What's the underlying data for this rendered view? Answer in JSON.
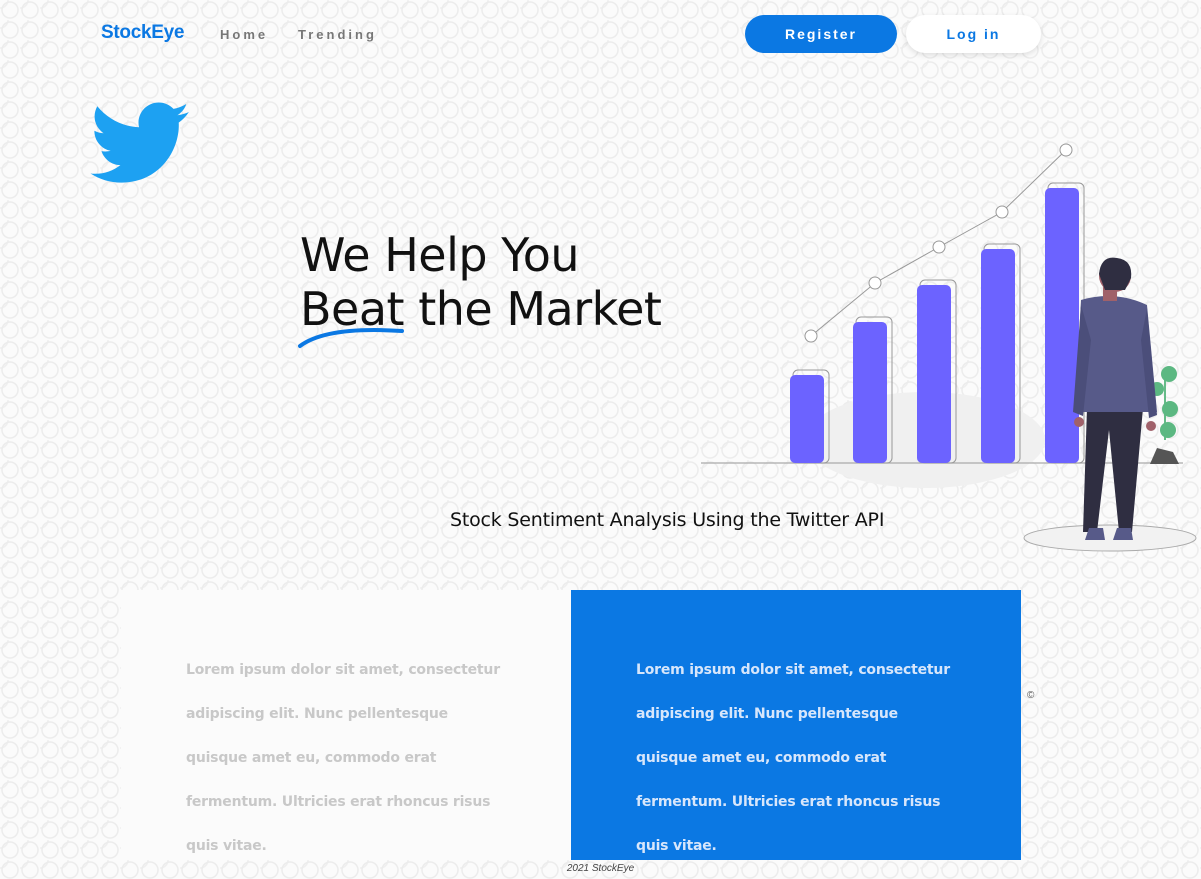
{
  "nav": {
    "logo": "StockEye",
    "links": [
      "Home",
      "Trending"
    ],
    "register_label": "Register",
    "login_label": "Log in"
  },
  "hero": {
    "title_line1": "We Help You",
    "title_line2_word1": "Beat",
    "title_line2_rest": " the Market",
    "subtitle": "Stock Sentiment Analysis Using the Twitter API"
  },
  "cards": [
    {
      "text": "Lorem ipsum dolor sit amet, consectetur adipiscing elit. Nunc pellentesque quisque amet eu, commodo erat fermentum. Ultricies erat rhoncus risus quis vitae."
    },
    {
      "text": "Lorem ipsum dolor sit amet, consectetur adipiscing elit. Nunc pellentesque quisque amet eu, commodo erat fermentum. Ultricies erat rhoncus risus quis vitae."
    }
  ],
  "footer": {
    "text": "2021 StockEye",
    "copyright_symbol": "©"
  },
  "colors": {
    "brand": "#0b78e3",
    "bird": "#1da1f2",
    "bars": "#6c63ff"
  },
  "icons": {
    "bird": "twitter-bird-icon"
  }
}
